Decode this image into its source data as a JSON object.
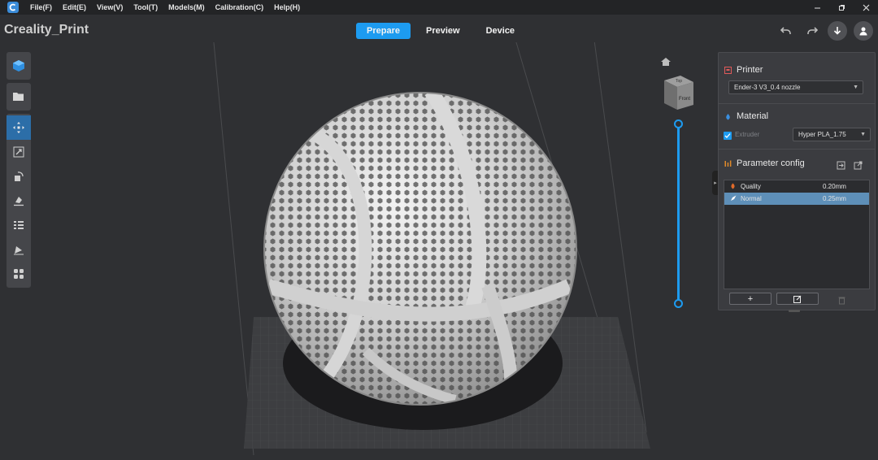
{
  "menubar": {
    "items": [
      "File(F)",
      "Edit(E)",
      "View(V)",
      "Tool(T)",
      "Models(M)",
      "Calibration(C)",
      "Help(H)"
    ],
    "window_controls": [
      "minimize-icon",
      "restore-icon",
      "close-icon"
    ]
  },
  "app": {
    "title": "Creality_Print"
  },
  "tabs": [
    {
      "label": "Prepare",
      "active": true
    },
    {
      "label": "Preview",
      "active": false
    },
    {
      "label": "Device",
      "active": false
    }
  ],
  "toolbar_right": [
    "undo-icon",
    "redo-icon",
    "download-icon",
    "user-icon"
  ],
  "left_toolbar": {
    "tools": [
      "add-model-icon",
      "open-file-icon",
      "move-icon",
      "scale-icon",
      "rotate-icon",
      "lay-flat-icon",
      "arrange-icon",
      "support-icon",
      "more-icon"
    ]
  },
  "view_cube": {
    "top_label": "Top",
    "front_label": "Front"
  },
  "layer_slider": {
    "top_value": 1.0,
    "bottom_value": 0.0
  },
  "panel": {
    "printer": {
      "title": "Printer",
      "selected": "Ender-3 V3_0.4 nozzle"
    },
    "material": {
      "title": "Material",
      "extruder_label": "Extruder",
      "selected": "Hyper PLA_1.75"
    },
    "params": {
      "title": "Parameter config",
      "rows": [
        {
          "name": "Quality",
          "value": "0.20mm",
          "selected": false
        },
        {
          "name": "Normal",
          "value": "0.25mm",
          "selected": true
        }
      ]
    },
    "buttons": [
      "add-icon",
      "edit-icon",
      "delete-icon"
    ]
  },
  "colors": {
    "accent": "#1d9bf0",
    "background": "#2f3033",
    "panel": "#3b3c40"
  }
}
